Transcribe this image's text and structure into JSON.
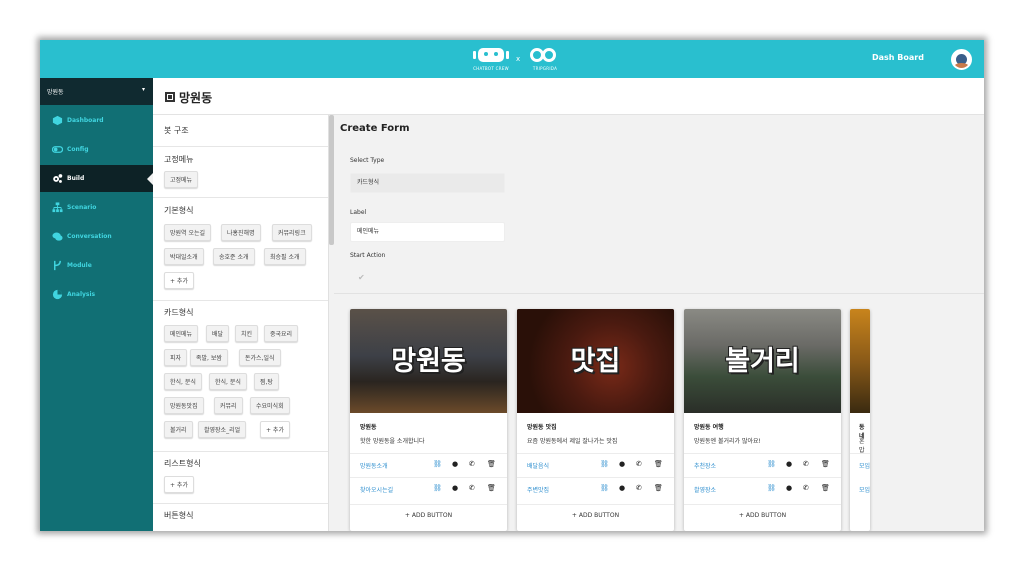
{
  "brand": {
    "logo_left_text": "CHATBOT CREW",
    "separator": "x",
    "logo_right_text": "TRIPGRIDA"
  },
  "topbar": {
    "dashboard_label": "Dash Board",
    "color": "#29bfcf"
  },
  "sidebar": {
    "project": "망원동",
    "items": [
      {
        "label": "Dashboard",
        "icon": "cube-icon"
      },
      {
        "label": "Config",
        "icon": "toggle-icon"
      },
      {
        "label": "Build",
        "icon": "gears-icon",
        "active": true
      },
      {
        "label": "Scenario",
        "icon": "sitemap-icon"
      },
      {
        "label": "Conversation",
        "icon": "chat-icon"
      },
      {
        "label": "Module",
        "icon": "fork-icon"
      },
      {
        "label": "Analysis",
        "icon": "pie-chart-icon"
      }
    ]
  },
  "page": {
    "title": "망원동"
  },
  "bot_structure": {
    "title": "봇 구조",
    "sections": [
      {
        "label": "고정메뉴",
        "chips": [
          "고정메뉴"
        ]
      },
      {
        "label": "기본형식",
        "chips": [
          "망원역 오는길",
          "나홍진해명",
          "커뮤리링크",
          "박대일소개",
          "송호준 소개",
          "최승필 소개",
          "+ 추가"
        ]
      },
      {
        "label": "카드형식",
        "chips": [
          "메인메뉴",
          "배달",
          "치킨",
          "중국요리",
          "피자",
          "족발, 보쌈",
          "돈가스,일식",
          "한식, 분식",
          "한식, 분식",
          "찜,탕",
          "망원동맛집",
          "커뮤리",
          "수요미식회",
          "볼거리",
          "촬영장소_리얼",
          "+ 추가"
        ]
      },
      {
        "label": "리스트형식",
        "chips": [
          "+ 추가"
        ]
      },
      {
        "label": "버튼형식",
        "chips": []
      }
    ]
  },
  "form": {
    "title": "Create Form",
    "select_type_label": "Select Type",
    "select_type_value": "카드형식",
    "label_label": "Label",
    "label_value": "메인메뉴",
    "start_action_label": "Start Action"
  },
  "cards": [
    {
      "image_text": "망원동",
      "title": "망원동",
      "desc": "핫한 망원동을 소개합니다",
      "buttons": [
        "망원동소개",
        "찾아오시는길"
      ],
      "add_label": "+ ADD BUTTON"
    },
    {
      "image_text": "맛집",
      "title": "망원동 맛집",
      "desc": "요즘 망원동에서 제일 잘나가는 맛집",
      "buttons": [
        "배달음식",
        "주변맛집"
      ],
      "add_label": "+ ADD BUTTON"
    },
    {
      "image_text": "볼거리",
      "title": "망원동 여행",
      "desc": "망원동엔 볼거리가 많아요!",
      "buttons": [
        "추천장소",
        "촬영장소"
      ],
      "add_label": "+ ADD BUTTON"
    },
    {
      "image_text": "",
      "title": "동네",
      "desc": "혼밥",
      "buttons": [
        "모임",
        "모임"
      ],
      "add_label": ""
    }
  ]
}
